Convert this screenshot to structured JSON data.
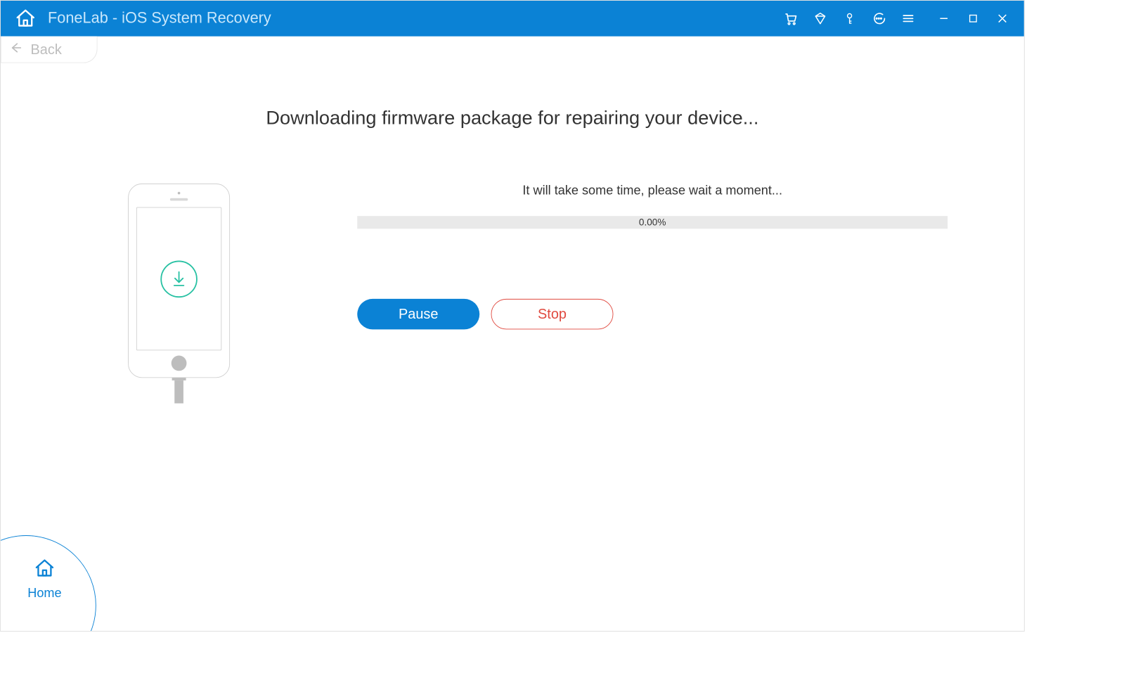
{
  "titlebar": {
    "app_title": "FoneLab - iOS System Recovery"
  },
  "nav": {
    "back_label": "Back"
  },
  "main": {
    "heading": "Downloading firmware package for repairing your device...",
    "wait_message": "It will take some time, please wait a moment...",
    "progress_percent": "0.00%",
    "pause_label": "Pause",
    "stop_label": "Stop"
  },
  "home": {
    "label": "Home"
  },
  "colors": {
    "primary": "#0b82d5",
    "accent_green": "#28c1a3",
    "danger": "#e0493f"
  }
}
